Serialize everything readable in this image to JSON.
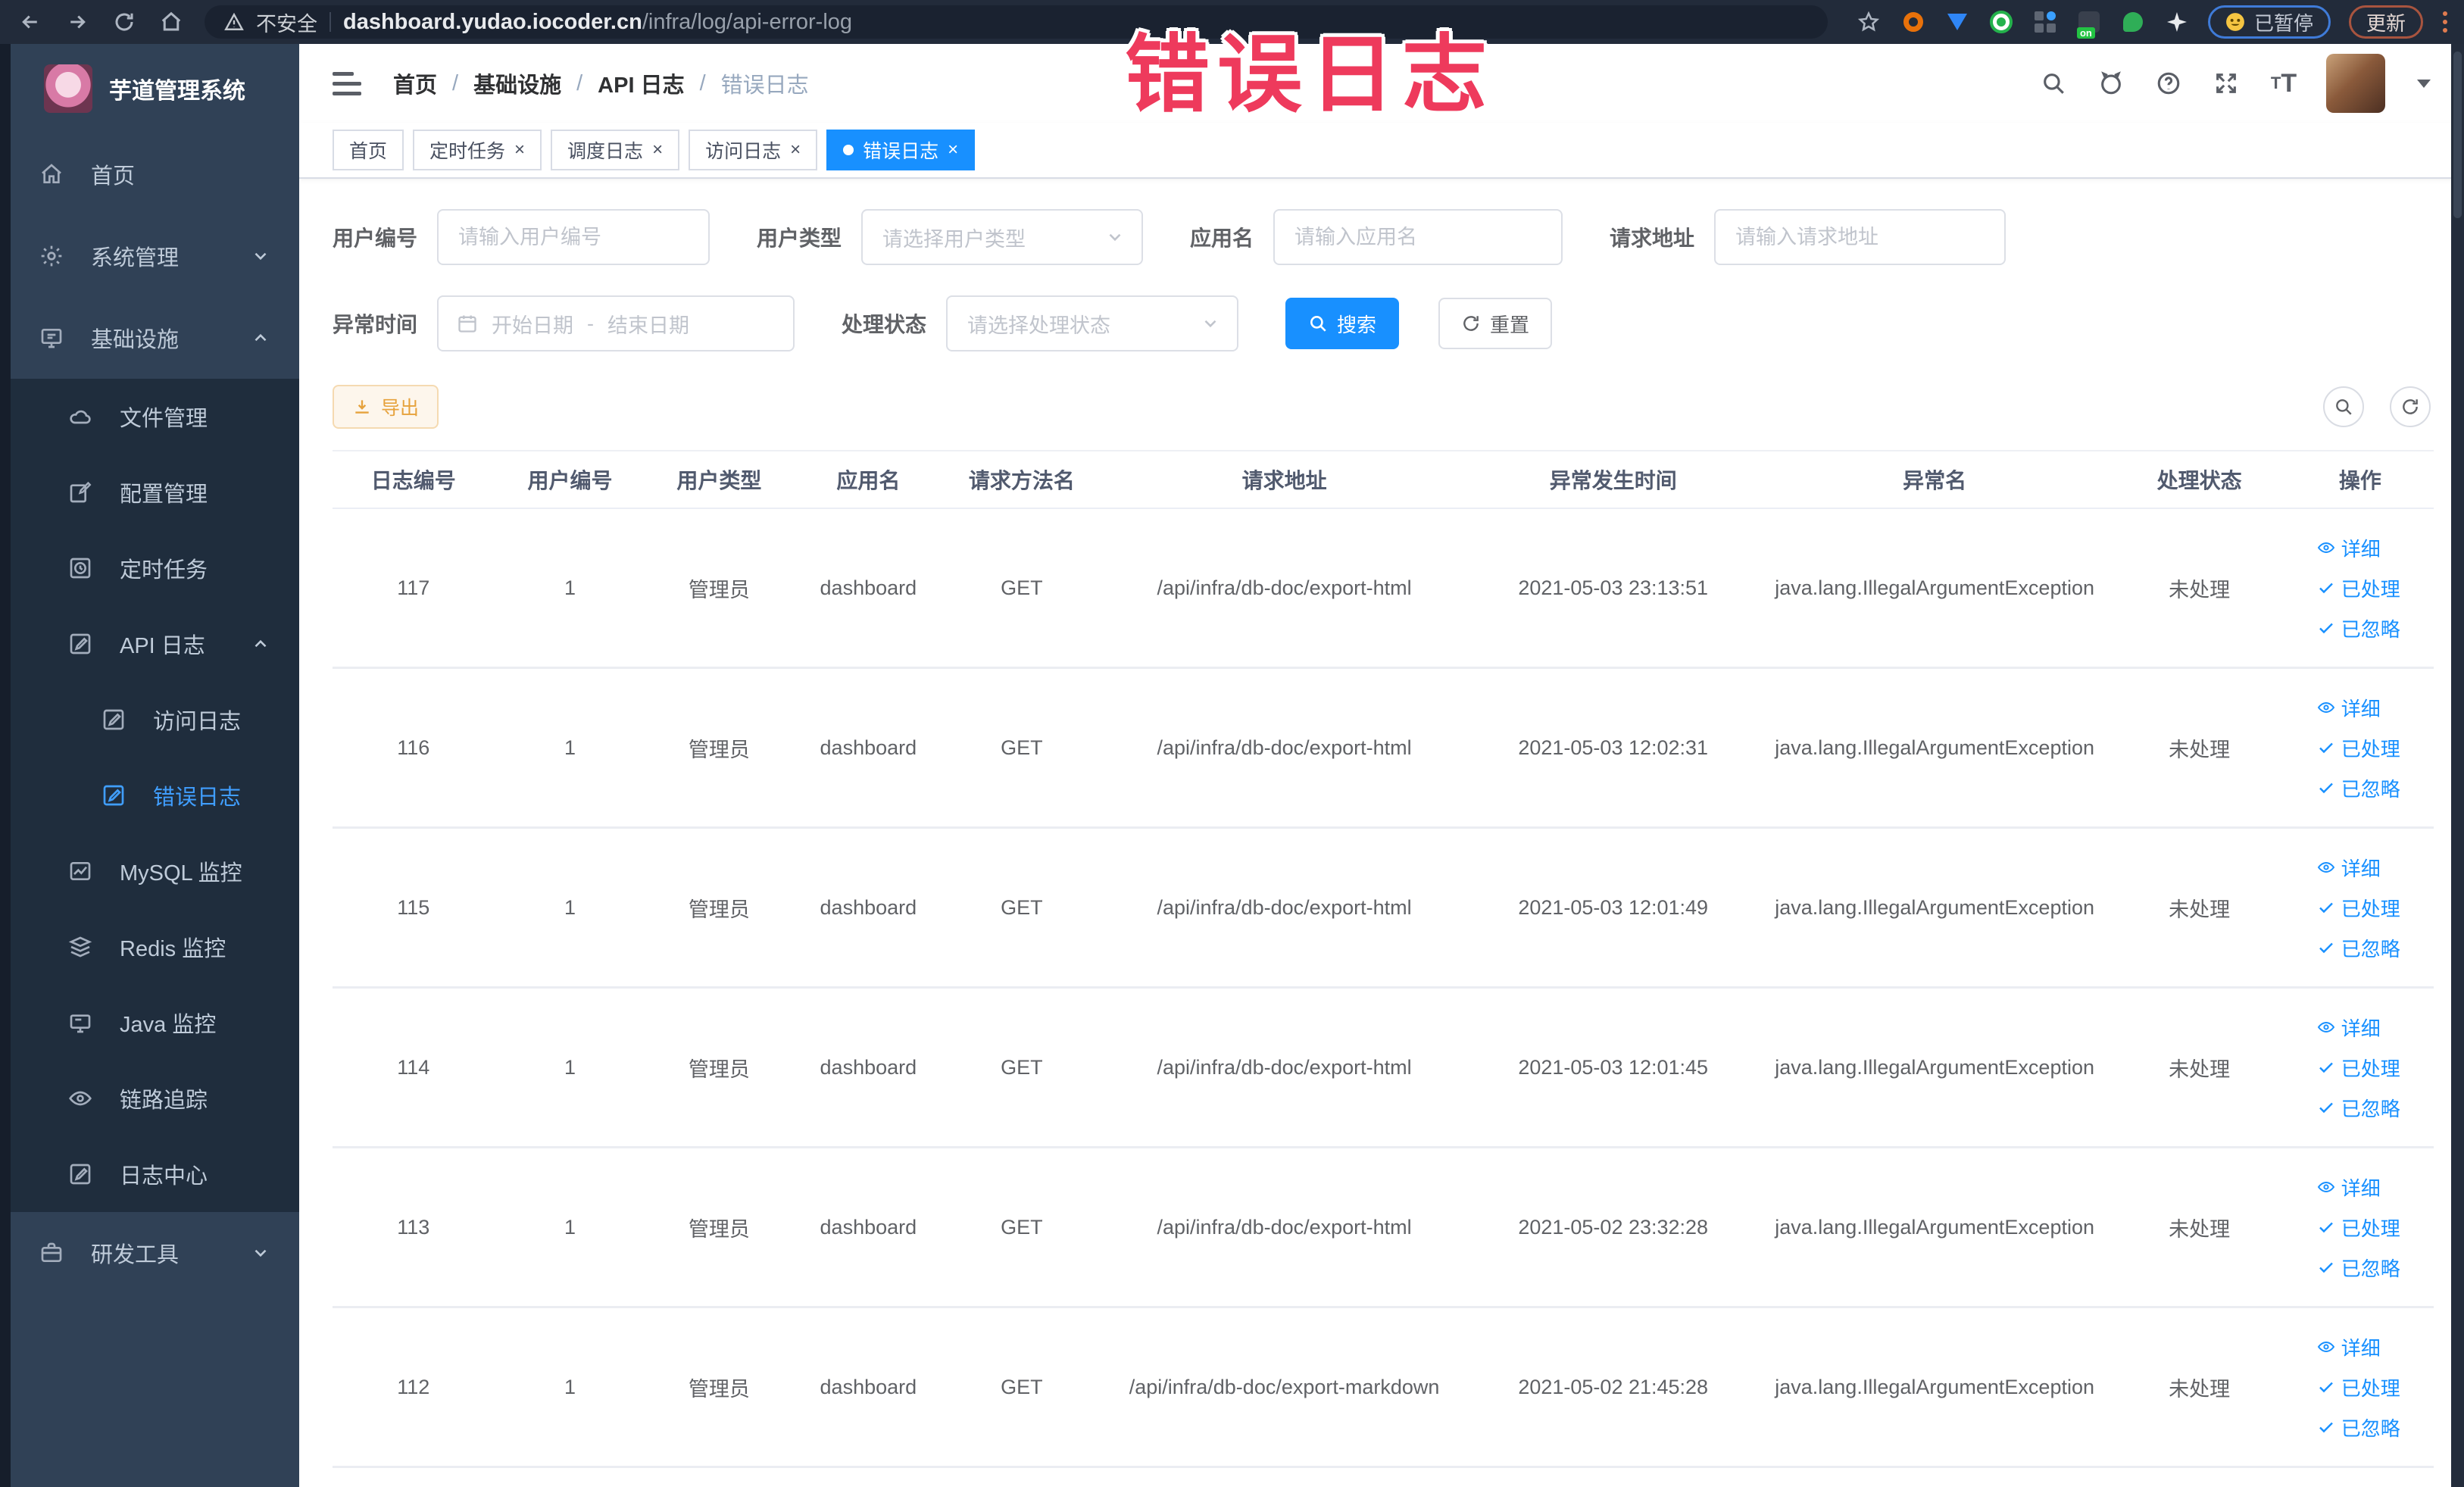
{
  "browser": {
    "security_label": "不安全",
    "url_domain": "dashboard.yudao.iocoder.cn",
    "url_path": "/infra/log/api-error-log",
    "paused_label": "已暂停",
    "update_label": "更新"
  },
  "annotation": {
    "text": "错误日志"
  },
  "sidebar": {
    "title": "芋道管理系统",
    "home": "首页",
    "system": "系统管理",
    "infra": "基础设施",
    "file": "文件管理",
    "config": "配置管理",
    "job": "定时任务",
    "apilog": "API 日志",
    "access": "访问日志",
    "error": "错误日志",
    "mysql": "MySQL 监控",
    "redis": "Redis 监控",
    "java": "Java 监控",
    "trace": "链路追踪",
    "logcenter": "日志中心",
    "devtools": "研发工具"
  },
  "breadcrumb": [
    "首页",
    "基础设施",
    "API 日志",
    "错误日志"
  ],
  "tabs": [
    {
      "label": "首页"
    },
    {
      "label": "定时任务"
    },
    {
      "label": "调度日志"
    },
    {
      "label": "访问日志"
    },
    {
      "label": "错误日志"
    }
  ],
  "filters": {
    "user_id": {
      "label": "用户编号",
      "placeholder": "请输入用户编号"
    },
    "user_type": {
      "label": "用户类型",
      "placeholder": "请选择用户类型"
    },
    "app_name": {
      "label": "应用名",
      "placeholder": "请输入应用名"
    },
    "request_url": {
      "label": "请求地址",
      "placeholder": "请输入请求地址"
    },
    "exception_time": {
      "label": "异常时间",
      "start_placeholder": "开始日期",
      "separator": "-",
      "end_placeholder": "结束日期"
    },
    "process_status": {
      "label": "处理状态",
      "placeholder": "请选择处理状态"
    },
    "search_label": "搜索",
    "reset_label": "重置"
  },
  "toolbar": {
    "export_label": "导出"
  },
  "table": {
    "headers": [
      "日志编号",
      "用户编号",
      "用户类型",
      "应用名",
      "请求方法名",
      "请求地址",
      "异常发生时间",
      "异常名",
      "处理状态",
      "操作"
    ],
    "row_actions": [
      "详细",
      "已处理",
      "已忽略"
    ],
    "rows": [
      {
        "id": "117",
        "user_id": "1",
        "user_type": "管理员",
        "app": "dashboard",
        "method": "GET",
        "url": "/api/infra/db-doc/export-html",
        "time": "2021-05-03 23:13:51",
        "exception": "java.lang.IllegalArgumentException",
        "status": "未处理"
      },
      {
        "id": "116",
        "user_id": "1",
        "user_type": "管理员",
        "app": "dashboard",
        "method": "GET",
        "url": "/api/infra/db-doc/export-html",
        "time": "2021-05-03 12:02:31",
        "exception": "java.lang.IllegalArgumentException",
        "status": "未处理"
      },
      {
        "id": "115",
        "user_id": "1",
        "user_type": "管理员",
        "app": "dashboard",
        "method": "GET",
        "url": "/api/infra/db-doc/export-html",
        "time": "2021-05-03 12:01:49",
        "exception": "java.lang.IllegalArgumentException",
        "status": "未处理"
      },
      {
        "id": "114",
        "user_id": "1",
        "user_type": "管理员",
        "app": "dashboard",
        "method": "GET",
        "url": "/api/infra/db-doc/export-html",
        "time": "2021-05-03 12:01:45",
        "exception": "java.lang.IllegalArgumentException",
        "status": "未处理"
      },
      {
        "id": "113",
        "user_id": "1",
        "user_type": "管理员",
        "app": "dashboard",
        "method": "GET",
        "url": "/api/infra/db-doc/export-html",
        "time": "2021-05-02 23:32:28",
        "exception": "java.lang.IllegalArgumentException",
        "status": "未处理"
      },
      {
        "id": "112",
        "user_id": "1",
        "user_type": "管理员",
        "app": "dashboard",
        "method": "GET",
        "url": "/api/infra/db-doc/export-markdown",
        "time": "2021-05-02 21:45:28",
        "exception": "java.lang.IllegalArgumentException",
        "status": "未处理"
      }
    ]
  },
  "colors": {
    "primary": "#1890ff",
    "sidebar_active": "#409eff",
    "annotation": "#ee3a5c",
    "sidebar_bg": "#304156",
    "submenu_bg": "#1f2d3d",
    "warning": "#e6a23c"
  }
}
